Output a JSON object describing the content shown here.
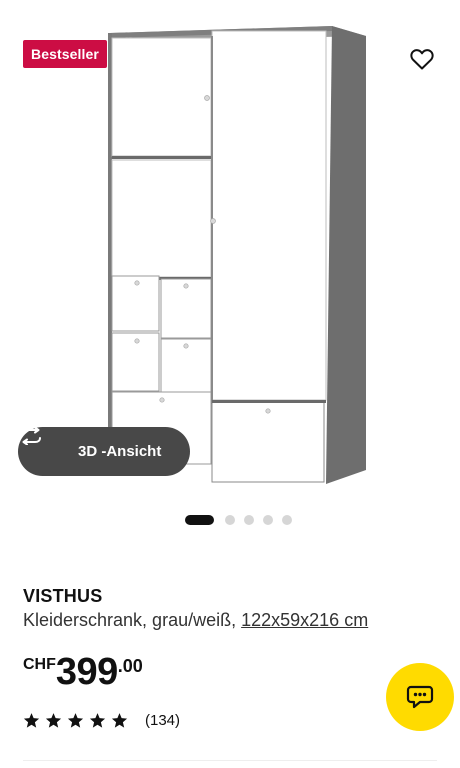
{
  "product": {
    "badge": "Bestseller",
    "name": "VISTHUS",
    "description": "Kleiderschrank, grau/weiß,",
    "measurements": "122x59x216 cm"
  },
  "image": {
    "view3d_label": "3D -Ansicht",
    "carousel": {
      "total": 5,
      "active": 1
    }
  },
  "price": {
    "currency": "CHF",
    "amount": "399",
    "cents": ".00"
  },
  "rating": {
    "stars": 5,
    "count_label": "(134)"
  },
  "icons": {
    "favorite": "heart-icon",
    "view3d": "rotate-icon",
    "chat": "chat-icon",
    "star": "star-icon"
  },
  "colors": {
    "badge": "#cc0d44",
    "chat": "#ffdb00",
    "view3d": "#484848"
  }
}
